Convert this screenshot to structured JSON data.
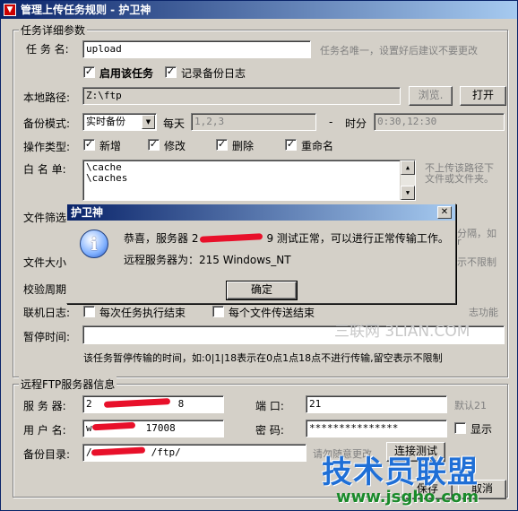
{
  "window": {
    "title": "管理上传任务规则 - 护卫神",
    "app_icon": "shield-app-icon"
  },
  "task_group": {
    "title": "任务详细参数",
    "task_name_label": "任 务 名:",
    "task_name_value": "upload",
    "task_name_hint": "任务名唯一，设置好后建议不要更改",
    "enable_task_label": "启用该任务",
    "enable_task_checked": true,
    "log_backup_label": "记录备份日志",
    "log_backup_checked": true,
    "local_path_label": "本地路径:",
    "local_path_value": "Z:\\ftp",
    "browse_label": "浏览.",
    "open_label": "打开",
    "backup_mode_label": "备份模式:",
    "backup_mode_value": "实时备份",
    "daily_label": "每天",
    "daily_value": "1,2,3",
    "dash": "-",
    "timeslot_label": "时分",
    "timeslot_value": "0:30,12:30",
    "op_type_label": "操作类型:",
    "op_types": [
      {
        "label": "新增",
        "checked": true
      },
      {
        "label": "修改",
        "checked": true
      },
      {
        "label": "删除",
        "checked": true
      },
      {
        "label": "重命名",
        "checked": true
      }
    ],
    "whitelist_label": "白 名 单:",
    "whitelist_lines": [
      "\\cache",
      "\\caches"
    ],
    "whitelist_hint_1": "不上传该路径下",
    "whitelist_hint_2": "文件或文件夹。",
    "file_filter_label": "文件筛选",
    "file_filter_hint_1": "分隔，如",
    "file_filter_hint_2": "r",
    "file_size_label": "文件大小",
    "file_size_hint": "示不限制",
    "verify_label": "校验周期",
    "verify_hint": "志功能",
    "online_log_label": "联机日志:",
    "online_log_option_1": "每次任务执行结束",
    "online_log_option_2": "每个文件传送结束",
    "pause_label": "暂停时间:",
    "pause_value": "",
    "pause_hint": "该任务暂停传输的时间，如:0|1|18表示在0点1点18点不进行传输,留空表示不限制"
  },
  "ftp_group": {
    "title": "远程FTP服务器信息",
    "server_label": "服 务 器:",
    "server_value": "2",
    "server_value_end": "8",
    "port_label": "端  口:",
    "port_value": "21",
    "port_hint": "默认21",
    "user_label": "用 户 名:",
    "user_value": "w",
    "user_value_end": "17008",
    "password_label": "密  码:",
    "password_value": "***************",
    "show_label": "显示",
    "show_checked": false,
    "backup_dir_label": "备份目录:",
    "backup_dir_value_start": "/",
    "backup_dir_value_end": "/ftp/",
    "backup_dir_hint": "请勿随意更改",
    "test_conn_label": "连接测试",
    "save_label": "保存",
    "cancel_label": "取消"
  },
  "dialog": {
    "title": "护卫神",
    "close_glyph": "✕",
    "icon": "info-icon",
    "icon_glyph": "i",
    "message_prefix": "恭喜，服务器 2",
    "message_suffix": "9 测试正常，可以进行正常传输工作。",
    "server_info": "远程服务器为：215 Windows_NT",
    "ok_label": "确定"
  },
  "watermarks": {
    "sanlian": "三联网 3LIAN.COM",
    "jsgho_title": "技术员联盟",
    "jsgho_url": "www.jsgho.com"
  },
  "colors": {
    "redaction": "#e8102a",
    "title_gradient_start": "#0a246a",
    "title_gradient_end": "#a6caf0",
    "watermark_blue": "#1f6fd6",
    "watermark_green": "#1a8a2a"
  }
}
